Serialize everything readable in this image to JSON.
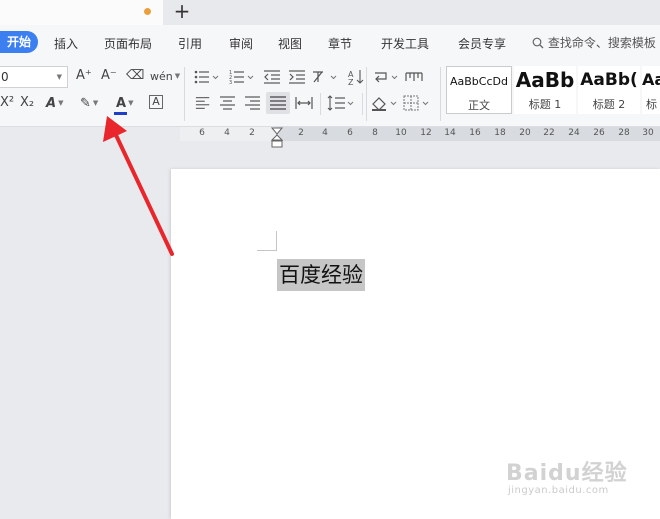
{
  "tabbar": {
    "new_tab": "+"
  },
  "menu": {
    "active": "开始",
    "items": [
      "插入",
      "页面布局",
      "引用",
      "审阅",
      "视图",
      "章节",
      "开发工具",
      "会员专享"
    ],
    "search_placeholder": "查找命令、搜索模板"
  },
  "ribbon": {
    "font_size": "0",
    "font_color": "#1f3fc7",
    "icons": {
      "grow_font": "A⁺",
      "shrink_font": "A⁻",
      "clear_format": "⌫",
      "pinyin": "wén",
      "superscript": "X²",
      "subscript": "X₂",
      "text_effect": "A",
      "highlight": "✎",
      "font_color": "A",
      "char_border": "A"
    }
  },
  "styles": [
    {
      "sample": "AaBbCcDd",
      "name": "正文"
    },
    {
      "sample": "AaBb",
      "name": "标题 1"
    },
    {
      "sample": "AaBb(",
      "name": "标题 2"
    },
    {
      "sample": "Aa",
      "name": "标"
    }
  ],
  "ruler": {
    "ticks": [
      "6",
      "4",
      "2",
      "2",
      "4",
      "6",
      "8",
      "10",
      "12",
      "14",
      "16",
      "18",
      "20",
      "22",
      "24",
      "26",
      "28",
      "30"
    ]
  },
  "document": {
    "text": "百度经验"
  },
  "annotation": {
    "arrow_color": "#e8262b"
  },
  "watermark": {
    "brand": "Baidu经验",
    "url": "jingyan.baidu.com"
  }
}
